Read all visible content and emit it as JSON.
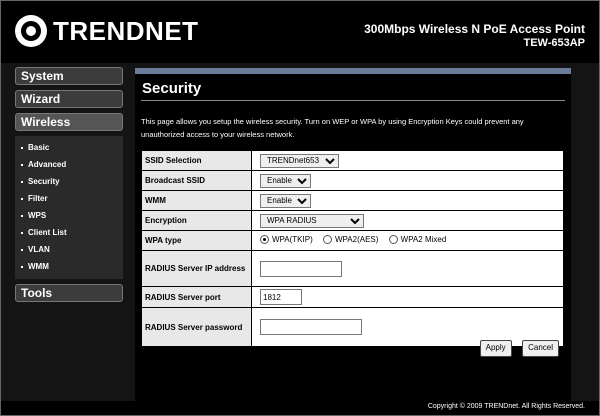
{
  "header": {
    "logo_text": "TRENDNET",
    "product_name": "300Mbps Wireless N PoE Access Point",
    "model": "TEW-653AP"
  },
  "sidebar": {
    "system_label": "System",
    "wizard_label": "Wizard",
    "wireless_label": "Wireless",
    "tools_label": "Tools",
    "wireless_items": [
      "Basic",
      "Advanced",
      "Security",
      "Filter",
      "WPS",
      "Client List",
      "VLAN",
      "WMM"
    ]
  },
  "main": {
    "title": "Security",
    "description": "This page allows you setup the wireless security. Turn on WEP or WPA by using Encryption Keys could prevent any unauthorized access to your wireless network."
  },
  "form": {
    "ssid_selection_label": "SSID Selection",
    "ssid_selection_value": "TRENDnet653",
    "broadcast_ssid_label": "Broadcast SSID",
    "broadcast_ssid_value": "Enable",
    "wmm_label": "WMM",
    "wmm_value": "Enable",
    "encryption_label": "Encryption",
    "encryption_value": "WPA RADIUS",
    "wpa_type_label": "WPA type",
    "wpa_type_options": [
      "WPA(TKIP)",
      "WPA2(AES)",
      "WPA2 Mixed"
    ],
    "wpa_type_selected": "WPA(TKIP)",
    "radius_ip_label": "RADIUS Server IP address",
    "radius_ip_value": "",
    "radius_port_label": "RADIUS Server port",
    "radius_port_value": "1812",
    "radius_password_label": "RADIUS Server password",
    "radius_password_value": ""
  },
  "buttons": {
    "apply_label": "Apply",
    "cancel_label": "Cancel"
  },
  "footer": {
    "copyright": "Copyright © 2009 TRENDnet. All Rights Reserved."
  }
}
